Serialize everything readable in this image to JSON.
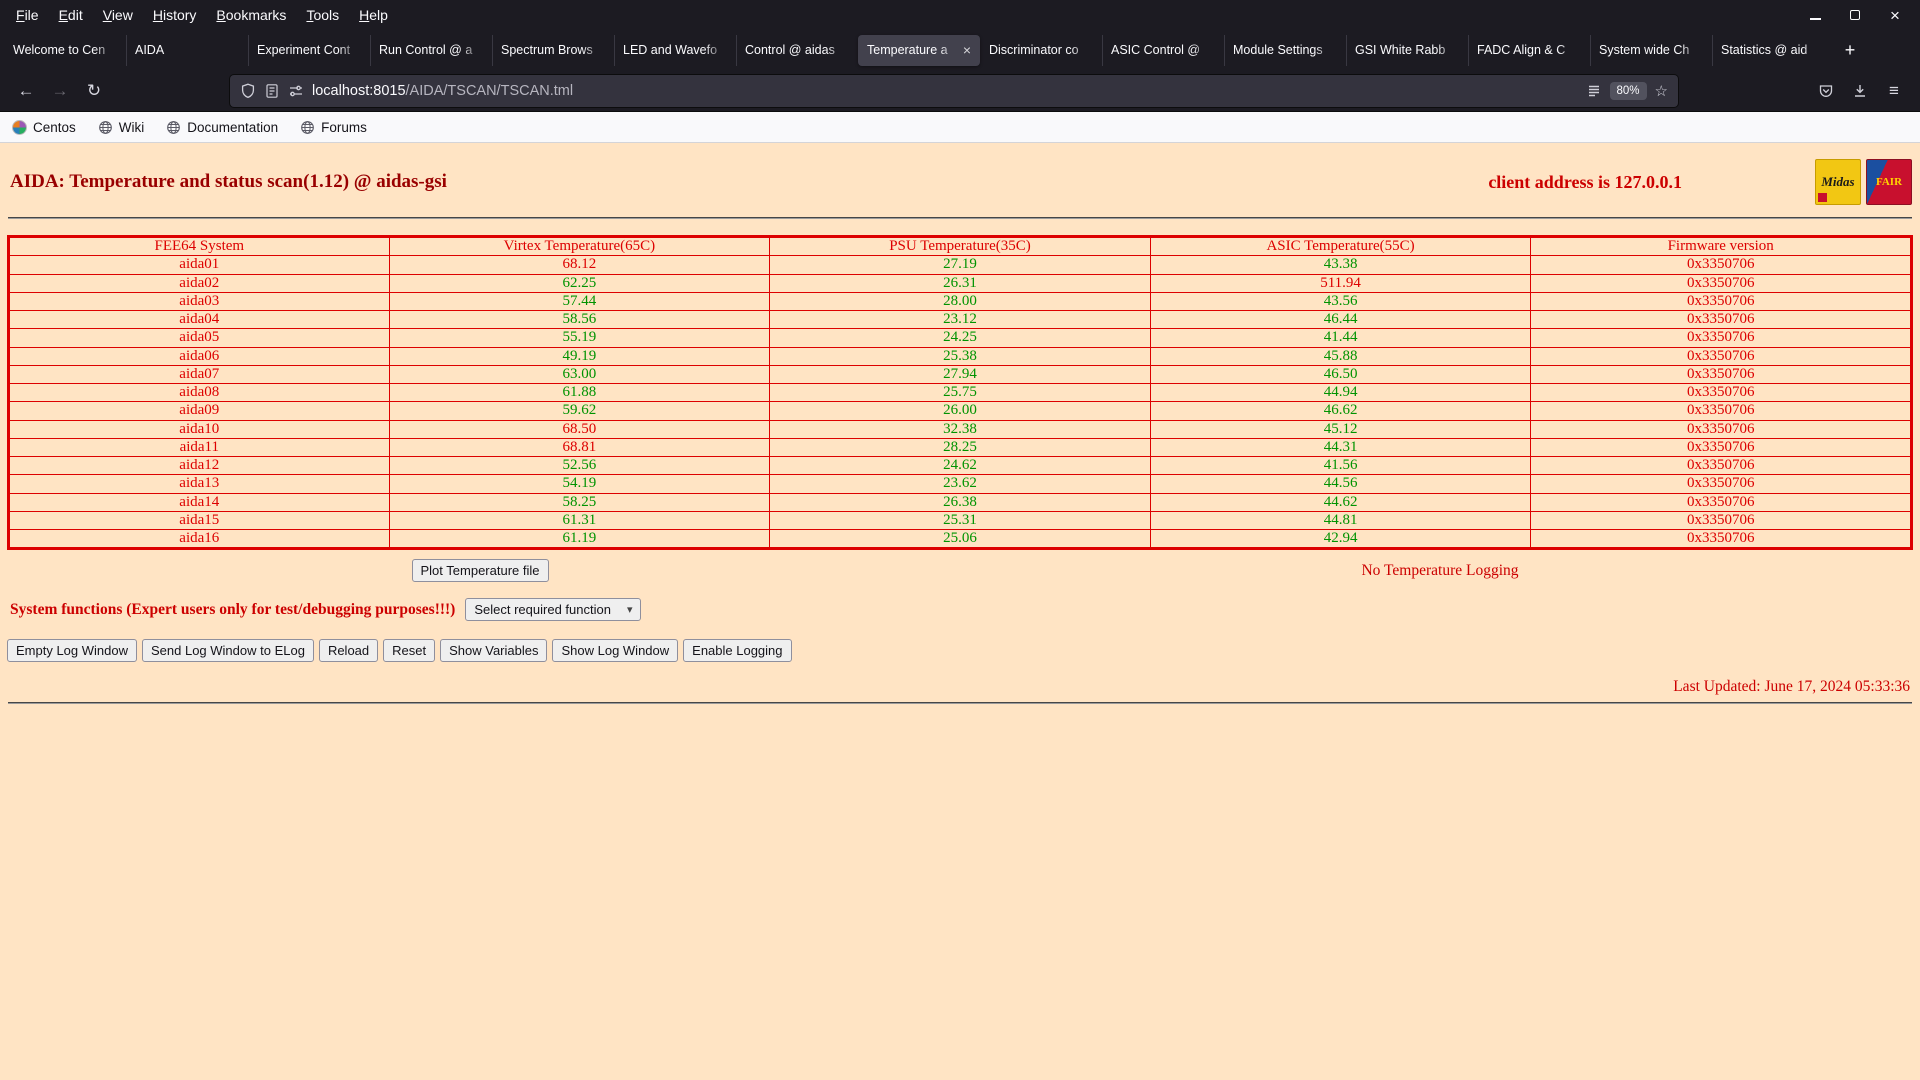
{
  "browser": {
    "menu": [
      "File",
      "Edit",
      "View",
      "History",
      "Bookmarks",
      "Tools",
      "Help"
    ],
    "tabs": [
      {
        "label": "Welcome to Cen",
        "active": false
      },
      {
        "label": "AIDA",
        "active": false
      },
      {
        "label": "Experiment Cont",
        "active": false
      },
      {
        "label": "Run Control @ a",
        "active": false
      },
      {
        "label": "Spectrum Brows",
        "active": false
      },
      {
        "label": "LED and Wavefo",
        "active": false
      },
      {
        "label": "Control @ aidas",
        "active": false
      },
      {
        "label": "Temperature a",
        "active": true
      },
      {
        "label": "Discriminator co",
        "active": false
      },
      {
        "label": "ASIC Control @",
        "active": false
      },
      {
        "label": "Module Settings",
        "active": false
      },
      {
        "label": "GSI White Rabb",
        "active": false
      },
      {
        "label": "FADC Align & C",
        "active": false
      },
      {
        "label": "System wide Ch",
        "active": false
      },
      {
        "label": "Statistics @ aid",
        "active": false
      }
    ],
    "url_host": "localhost:8015",
    "url_path": "/AIDA/TSCAN/TSCAN.tml",
    "zoom_badge": "80%",
    "bookmarks": [
      "Centos",
      "Wiki",
      "Documentation",
      "Forums"
    ],
    "icons": {
      "close": "×",
      "new_tab": "+",
      "back": "←",
      "forward": "→",
      "reload": "↻",
      "star": "☆",
      "hamburger": "≡",
      "caret": "▾"
    }
  },
  "page": {
    "title": "AIDA: Temperature and status scan(1.12) @ aidas-gsi",
    "client_address": "client address is 127.0.0.1",
    "logos": {
      "midas": "Midas",
      "fair": "FAIR"
    },
    "table": {
      "headers": [
        "FEE64 System",
        "Virtex Temperature(65C)",
        "PSU Temperature(35C)",
        "ASIC Temperature(55C)",
        "Firmware version"
      ],
      "limits": [
        65,
        35,
        55
      ],
      "rows": [
        {
          "name": "aida01",
          "virtex": "68.12",
          "psu": "27.19",
          "asic": "43.38",
          "firmware": "0x3350706"
        },
        {
          "name": "aida02",
          "virtex": "62.25",
          "psu": "26.31",
          "asic": "511.94",
          "firmware": "0x3350706"
        },
        {
          "name": "aida03",
          "virtex": "57.44",
          "psu": "28.00",
          "asic": "43.56",
          "firmware": "0x3350706"
        },
        {
          "name": "aida04",
          "virtex": "58.56",
          "psu": "23.12",
          "asic": "46.44",
          "firmware": "0x3350706"
        },
        {
          "name": "aida05",
          "virtex": "55.19",
          "psu": "24.25",
          "asic": "41.44",
          "firmware": "0x3350706"
        },
        {
          "name": "aida06",
          "virtex": "49.19",
          "psu": "25.38",
          "asic": "45.88",
          "firmware": "0x3350706"
        },
        {
          "name": "aida07",
          "virtex": "63.00",
          "psu": "27.94",
          "asic": "46.50",
          "firmware": "0x3350706"
        },
        {
          "name": "aida08",
          "virtex": "61.88",
          "psu": "25.75",
          "asic": "44.94",
          "firmware": "0x3350706"
        },
        {
          "name": "aida09",
          "virtex": "59.62",
          "psu": "26.00",
          "asic": "46.62",
          "firmware": "0x3350706"
        },
        {
          "name": "aida10",
          "virtex": "68.50",
          "psu": "32.38",
          "asic": "45.12",
          "firmware": "0x3350706"
        },
        {
          "name": "aida11",
          "virtex": "68.81",
          "psu": "28.25",
          "asic": "44.31",
          "firmware": "0x3350706"
        },
        {
          "name": "aida12",
          "virtex": "52.56",
          "psu": "24.62",
          "asic": "41.56",
          "firmware": "0x3350706"
        },
        {
          "name": "aida13",
          "virtex": "54.19",
          "psu": "23.62",
          "asic": "44.56",
          "firmware": "0x3350706"
        },
        {
          "name": "aida14",
          "virtex": "58.25",
          "psu": "26.38",
          "asic": "44.62",
          "firmware": "0x3350706"
        },
        {
          "name": "aida15",
          "virtex": "61.31",
          "psu": "25.31",
          "asic": "44.81",
          "firmware": "0x3350706"
        },
        {
          "name": "aida16",
          "virtex": "61.19",
          "psu": "25.06",
          "asic": "42.94",
          "firmware": "0x3350706"
        }
      ]
    },
    "plot_button": "Plot Temperature file",
    "logging_status": "No Temperature Logging",
    "system_functions_label": "System functions (Expert users only for test/debugging purposes!!!)",
    "function_select_value": "Select required function",
    "action_buttons": [
      "Empty Log Window",
      "Send Log Window to ELog",
      "Reload",
      "Reset",
      "Show Variables",
      "Show Log Window",
      "Enable Logging"
    ],
    "last_updated": "Last Updated: June 17, 2024 05:33:36"
  },
  "colors": {
    "page_background": "#ffe4c4",
    "title_red": "#990000",
    "alert_red": "#cc0000",
    "ok_green": "#009300",
    "table_border_red": "#dd0000"
  }
}
